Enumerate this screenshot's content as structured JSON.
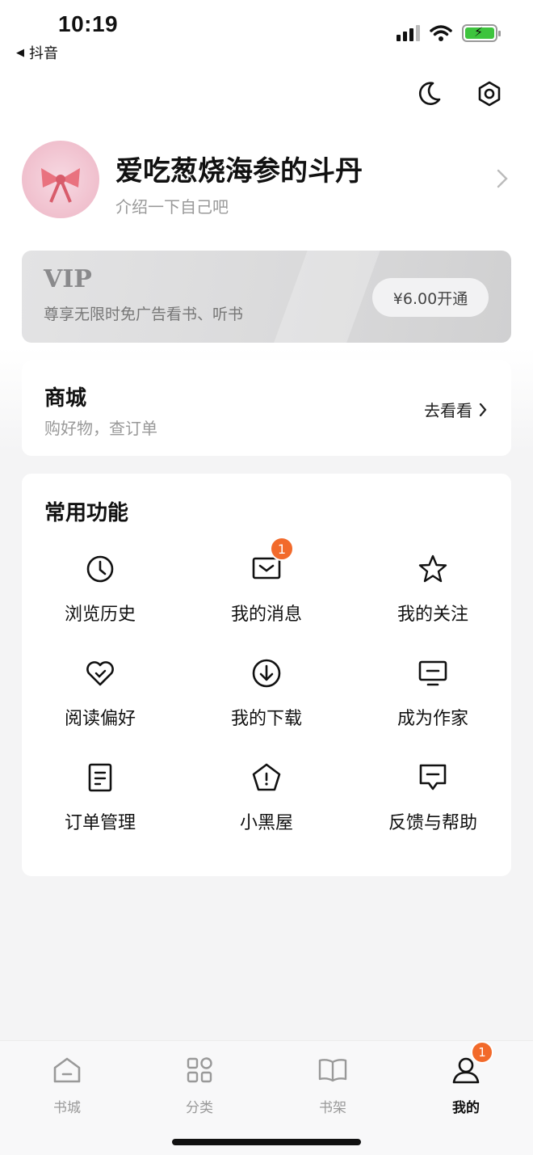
{
  "status_bar": {
    "time": "10:19",
    "back_app": "抖音"
  },
  "header": {
    "icons": [
      {
        "name": "moon-icon"
      },
      {
        "name": "settings-icon"
      }
    ]
  },
  "profile": {
    "nickname": "爱吃葱烧海参的斗丹",
    "bio": "介绍一下自己吧"
  },
  "vip": {
    "title": "VIP",
    "subtitle": "尊享无限时免广告看书、听书",
    "button_label": "¥6.00开通"
  },
  "mall": {
    "title": "商城",
    "subtitle": "购好物，查订单",
    "link_label": "去看看"
  },
  "functions": {
    "title": "常用功能",
    "items": [
      {
        "label": "浏览历史",
        "icon": "clock-icon"
      },
      {
        "label": "我的消息",
        "icon": "message-icon",
        "badge": "1"
      },
      {
        "label": "我的关注",
        "icon": "star-icon"
      },
      {
        "label": "阅读偏好",
        "icon": "heart-check-icon"
      },
      {
        "label": "我的下载",
        "icon": "download-icon"
      },
      {
        "label": "成为作家",
        "icon": "monitor-icon"
      },
      {
        "label": "订单管理",
        "icon": "document-icon"
      },
      {
        "label": "小黑屋",
        "icon": "pentagon-icon"
      },
      {
        "label": "反馈与帮助",
        "icon": "feedback-icon"
      }
    ]
  },
  "bottom_nav": {
    "items": [
      {
        "label": "书城",
        "icon": "home-icon"
      },
      {
        "label": "分类",
        "icon": "category-icon"
      },
      {
        "label": "书架",
        "icon": "bookshelf-icon"
      },
      {
        "label": "我的",
        "icon": "profile-icon",
        "badge": "1",
        "active": true
      }
    ]
  },
  "colors": {
    "badge": "#f26a2b",
    "vip_card": "#dadadb",
    "background": "#f4f4f5"
  }
}
